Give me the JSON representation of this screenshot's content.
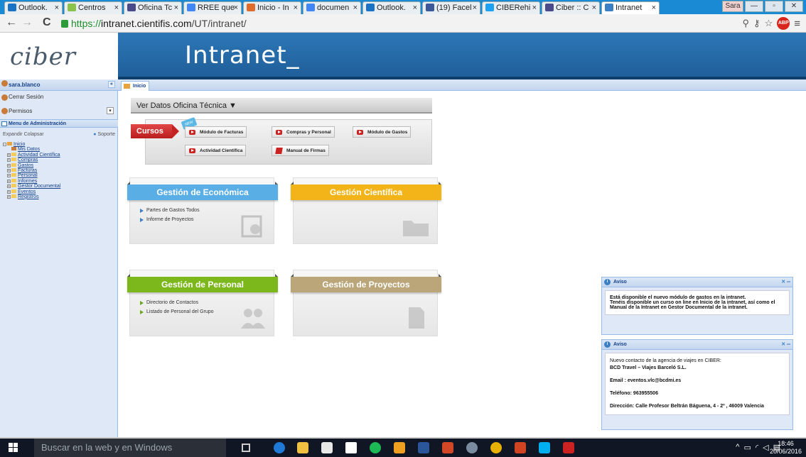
{
  "browser": {
    "tabs": [
      {
        "label": "Outlook.",
        "color": "#1b73c5"
      },
      {
        "label": "Centros",
        "color": "#8bc34a"
      },
      {
        "label": "Oficina Tc",
        "color": "#4a4a8a"
      },
      {
        "label": "RREE que",
        "color": "#4285f4"
      },
      {
        "label": "Inicio - In",
        "color": "#e06c2c"
      },
      {
        "label": "documen",
        "color": "#4285f4"
      },
      {
        "label": "Outlook.",
        "color": "#1b73c5"
      },
      {
        "label": "(19) Facel",
        "color": "#3b5998"
      },
      {
        "label": "CIBERehi",
        "color": "#1da1f2"
      },
      {
        "label": "Ciber :: C",
        "color": "#4a4a8a"
      },
      {
        "label": "Intranet",
        "color": "#3b7fc4"
      }
    ],
    "user_button": "Sara",
    "url_scheme": "https://",
    "url_host": "intranet.cientifis.com",
    "url_path": "/UT/intranet/",
    "abp_label": "ABP"
  },
  "header": {
    "logo": "ciber",
    "title": "Intranet_"
  },
  "sidebar": {
    "username": "sara.blanco",
    "logout": "Cerrar Sesión",
    "permisos": "Permisos",
    "menu_title": "Menu de Administración",
    "expand": "Expandir",
    "collapse": "Colapsar",
    "support": "Soporte",
    "tree": [
      {
        "label": "Inicio",
        "level": 0,
        "kind": "home"
      },
      {
        "label": "Mis Datos",
        "level": 1,
        "kind": "user"
      },
      {
        "label": "Actividad Científica",
        "level": 1,
        "kind": "folder"
      },
      {
        "label": "Compras",
        "level": 1,
        "kind": "folder"
      },
      {
        "label": "Gastos",
        "level": 1,
        "kind": "folder"
      },
      {
        "label": "Facturas",
        "level": 1,
        "kind": "folder"
      },
      {
        "label": "Personal",
        "level": 1,
        "kind": "folder"
      },
      {
        "label": "Informes",
        "level": 1,
        "kind": "folder"
      },
      {
        "label": "Gestor Documental",
        "level": 1,
        "kind": "folder"
      },
      {
        "label": "Eventos",
        "level": 1,
        "kind": "folder"
      },
      {
        "label": "Registros",
        "level": 1,
        "kind": "folder"
      }
    ]
  },
  "main": {
    "tab_label": "Inicio",
    "ver_datos": "Ver Datos Oficina Técnica",
    "cursos_label": "Cursos",
    "new_badge": "NEW",
    "cursos_buttons": [
      {
        "label": "Módulo de Facturas",
        "icon": "video"
      },
      {
        "label": "Compras y Personal",
        "icon": "video"
      },
      {
        "label": "Módulo de Gastos",
        "icon": "video"
      },
      {
        "label": "Actividad Científica",
        "icon": "video"
      },
      {
        "label": "Manual de Firmas",
        "icon": "pdf"
      }
    ],
    "panels": [
      {
        "title": "Gestión de Económica",
        "color": "#5aaee6",
        "items": [
          "Partes de Gastos Todos",
          "Informe de Proyectos"
        ]
      },
      {
        "title": "Gestión Científica",
        "color": "#f2b418",
        "items": []
      },
      {
        "title": "Gestión de Personal",
        "color": "#7cb81c",
        "items": [
          "Directorio de Contactos",
          "Listado de Personal del Grupo"
        ]
      },
      {
        "title": "Gestión de Proyectos",
        "color": "#bba67a",
        "items": []
      }
    ]
  },
  "avisos": [
    {
      "title": "Aviso",
      "lines": [
        "Está disponible el nuevo módulo de gastos en la intranet.",
        "Tenéis disponible un curso on line en Inicio de la intranet, así como el Manual de la Intranet en Gestor Documental de la intranet."
      ]
    },
    {
      "title": "Aviso",
      "intro": "Nuevo contacto de la agencia de viajes en CIBER:",
      "agency": "BCD Travel – Viajes Barceló S.L.",
      "email": "Email : eventos.vlc@bcdmi.es",
      "phone": "Teléfono: 963955506",
      "address": "Dirección: Calle Profesor Beltrán Báguena, 4 - 2º , 46009 Valencia"
    }
  ],
  "taskbar": {
    "search_placeholder": "Buscar en la web y en Windows",
    "time": "18:46",
    "date": "20/06/2016"
  }
}
